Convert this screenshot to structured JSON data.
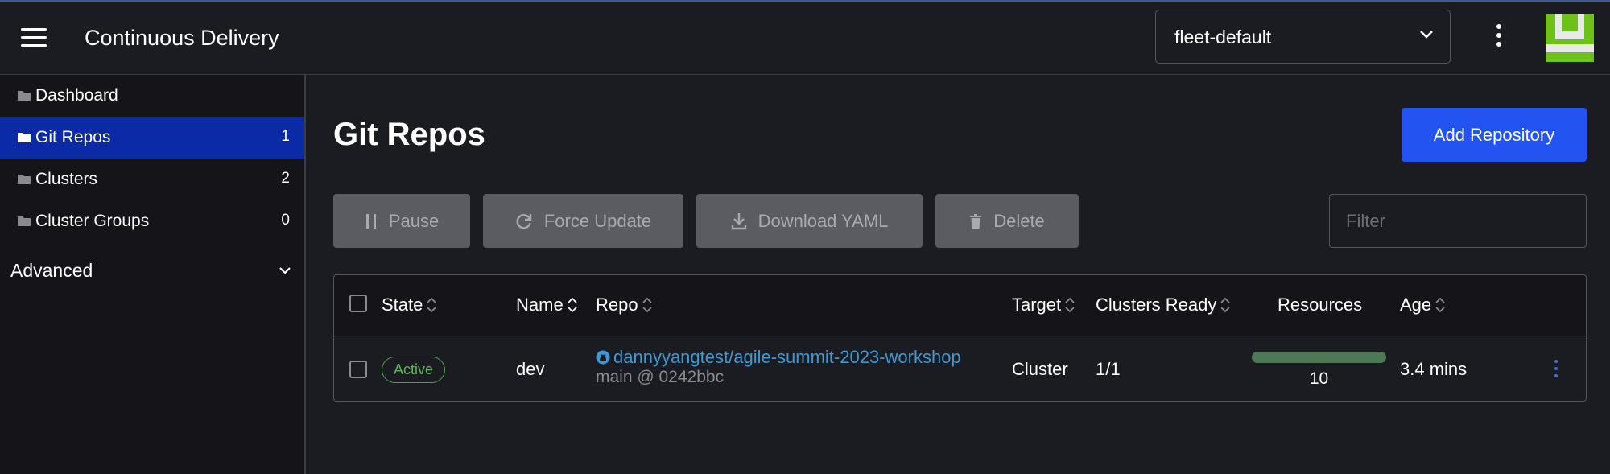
{
  "header": {
    "app_title": "Continuous Delivery",
    "workspace": "fleet-default"
  },
  "sidebar": {
    "items": [
      {
        "label": "Dashboard",
        "count": ""
      },
      {
        "label": "Git Repos",
        "count": "1"
      },
      {
        "label": "Clusters",
        "count": "2"
      },
      {
        "label": "Cluster Groups",
        "count": "0"
      }
    ],
    "group_label": "Advanced"
  },
  "main": {
    "title": "Git Repos",
    "add_button": "Add Repository",
    "bulk_actions": {
      "pause": "Pause",
      "force_update": "Force Update",
      "download_yaml": "Download YAML",
      "delete": "Delete"
    },
    "filter_placeholder": "Filter"
  },
  "table": {
    "columns": {
      "state": "State",
      "name": "Name",
      "repo": "Repo",
      "target": "Target",
      "clusters_ready": "Clusters Ready",
      "resources": "Resources",
      "age": "Age"
    },
    "rows": [
      {
        "state": "Active",
        "name": "dev",
        "repo": "dannyyangtest/agile-summit-2023-workshop",
        "branch_commit": "main @ 0242bbc",
        "target": "Cluster",
        "clusters_ready": "1/1",
        "resources": "10",
        "resources_ready_fraction": 1.0,
        "age": "3.4 mins"
      }
    ]
  },
  "colors": {
    "accent": "#2353f0",
    "active_nav": "#0a2aa6",
    "status_active": "#5cb85c",
    "link": "#3d98d3",
    "resource_bar": "#4d7a55"
  }
}
